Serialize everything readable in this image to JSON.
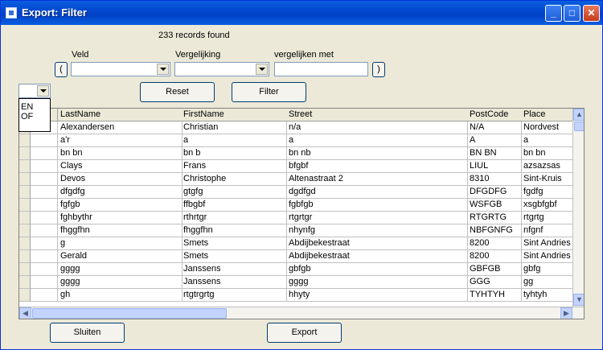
{
  "window": {
    "title": "Export: Filter"
  },
  "status": {
    "records_found": "233 records found"
  },
  "filter": {
    "open_paren": "(",
    "close_paren": ")",
    "field_label": "Veld",
    "comparison_label": "Vergelijking",
    "compare_with_label": "vergelijken met",
    "field_value": "",
    "comparison_value": "",
    "compare_with_value": "",
    "logic_value": "",
    "logic_options": [
      "EN",
      "OF"
    ]
  },
  "buttons": {
    "reset": "Reset",
    "filter": "Filter",
    "close": "Sluiten",
    "export": "Export"
  },
  "grid": {
    "columns": [
      "LastName",
      "FirstName",
      "Street",
      "PostCode",
      "Place"
    ],
    "rows": [
      [
        "Alexandersen",
        "Christian",
        "n/a",
        "N/A",
        "Nordvest"
      ],
      [
        "a'r",
        "a",
        "a",
        "A",
        "a"
      ],
      [
        "bn bn",
        "bn b",
        "bn nb",
        "BN BN",
        "bn bn"
      ],
      [
        "Clays",
        "Frans",
        "bfgbf",
        "LIUL",
        "azsazsas"
      ],
      [
        "Devos",
        "Christophe",
        "Altenastraat 2",
        "8310",
        "Sint-Kruis"
      ],
      [
        "dfgdfg",
        "gtgfg",
        "dgdfgd",
        "DFGDFG",
        "fgdfg"
      ],
      [
        "fgfgb",
        "ffbgbf",
        "fgbfgb",
        "WSFGB",
        "xsgbfgbf"
      ],
      [
        "fghbythr",
        "rthrtgr",
        "rtgrtgr",
        "RTGRTG",
        "rtgrtg"
      ],
      [
        "fhggfhn",
        "fhggfhn",
        "nhynfg",
        "NBFGNFG",
        "nfgnf"
      ],
      [
        "g",
        "Smets",
        "Abdijbekestraat",
        "8200",
        "Sint Andries"
      ],
      [
        "Gerald",
        "Smets",
        "Abdijbekestraat",
        "8200",
        "Sint Andries"
      ],
      [
        "gggg",
        "Janssens",
        "gbfgb",
        "GBFGB",
        "gbfg"
      ],
      [
        "gggg",
        "Janssens",
        "gggg",
        "GGG",
        "gg"
      ],
      [
        "gh",
        "rtgtrgrtg",
        "hhyty",
        "TYHTYH",
        "tyhtyh"
      ]
    ]
  }
}
